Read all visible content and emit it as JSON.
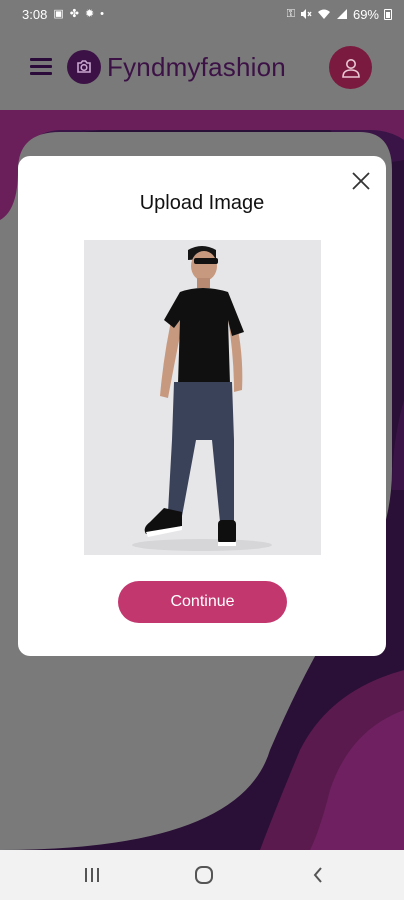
{
  "status_bar": {
    "time": "3:08",
    "battery": "69%",
    "left_icons": [
      "gallery-icon",
      "slack-icon",
      "settings-icon",
      "dot-icon"
    ],
    "right_icons": [
      "key-icon",
      "mute-icon",
      "wifi-icon",
      "signal-icon",
      "battery-icon"
    ]
  },
  "header": {
    "app_name": "Fyndmyfashion"
  },
  "modal": {
    "title": "Upload Image",
    "continue_label": "Continue"
  },
  "nav_bar": {
    "buttons": [
      "recents-icon",
      "home-icon",
      "back-icon"
    ]
  },
  "colors": {
    "overlay_gray": "#7a7a7a",
    "brand_purple": "#3c1246",
    "accent_pink": "#c3376f",
    "user_button": "#7a1a3e"
  }
}
